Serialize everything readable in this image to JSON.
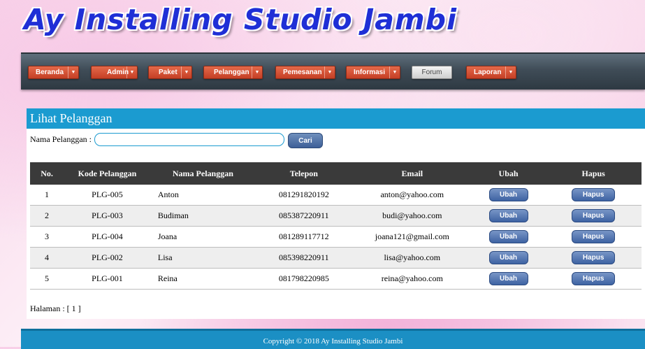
{
  "site": {
    "title": "Ay Installing Studio Jambi"
  },
  "nav": {
    "items": [
      {
        "label": "Beranda",
        "dropdown": true
      },
      {
        "label": "Admin",
        "dropdown": true
      },
      {
        "label": "Paket",
        "dropdown": true
      },
      {
        "label": "Pelanggan",
        "dropdown": true
      },
      {
        "label": "Pemesanan",
        "dropdown": true
      },
      {
        "label": "Informasi",
        "dropdown": true
      },
      {
        "label": "Forum",
        "dropdown": false
      },
      {
        "label": "Laporan",
        "dropdown": true
      }
    ],
    "caret_glyph": "▼"
  },
  "panel": {
    "title": "Lihat Pelanggan",
    "search_label": "Nama Pelanggan :",
    "search_value": "",
    "search_button": "Cari"
  },
  "table": {
    "headers": [
      "No.",
      "Kode Pelanggan",
      "Nama Pelanggan",
      "Telepon",
      "Email",
      "Ubah",
      "Hapus"
    ],
    "rows": [
      {
        "no": "1",
        "kode": "PLG-005",
        "nama": "Anton",
        "telepon": "081291820192",
        "email": "anton@yahoo.com",
        "ubah": "Ubah",
        "hapus": "Hapus"
      },
      {
        "no": "2",
        "kode": "PLG-003",
        "nama": "Budiman",
        "telepon": "085387220911",
        "email": "budi@yahoo.com",
        "ubah": "Ubah",
        "hapus": "Hapus"
      },
      {
        "no": "3",
        "kode": "PLG-004",
        "nama": "Joana",
        "telepon": "081289117712",
        "email": "joana121@gmail.com",
        "ubah": "Ubah",
        "hapus": "Hapus"
      },
      {
        "no": "4",
        "kode": "PLG-002",
        "nama": "Lisa",
        "telepon": "085398220911",
        "email": "lisa@yahoo.com",
        "ubah": "Ubah",
        "hapus": "Hapus"
      },
      {
        "no": "5",
        "kode": "PLG-001",
        "nama": "Reina",
        "telepon": "081798220985",
        "email": "reina@yahoo.com",
        "ubah": "Ubah",
        "hapus": "Hapus"
      }
    ]
  },
  "pager": {
    "text": "Halaman : [ 1 ]"
  },
  "footer": {
    "text": "Copyright © 2018 Ay Installing Studio Jambi"
  },
  "colors": {
    "nav_button": "#d4532f",
    "panel_header": "#1b9bd0",
    "table_header": "#3a3a3a",
    "row_button": "#4a6ba8",
    "footer": "#1b8fc4",
    "title": "#1f2fd6"
  }
}
